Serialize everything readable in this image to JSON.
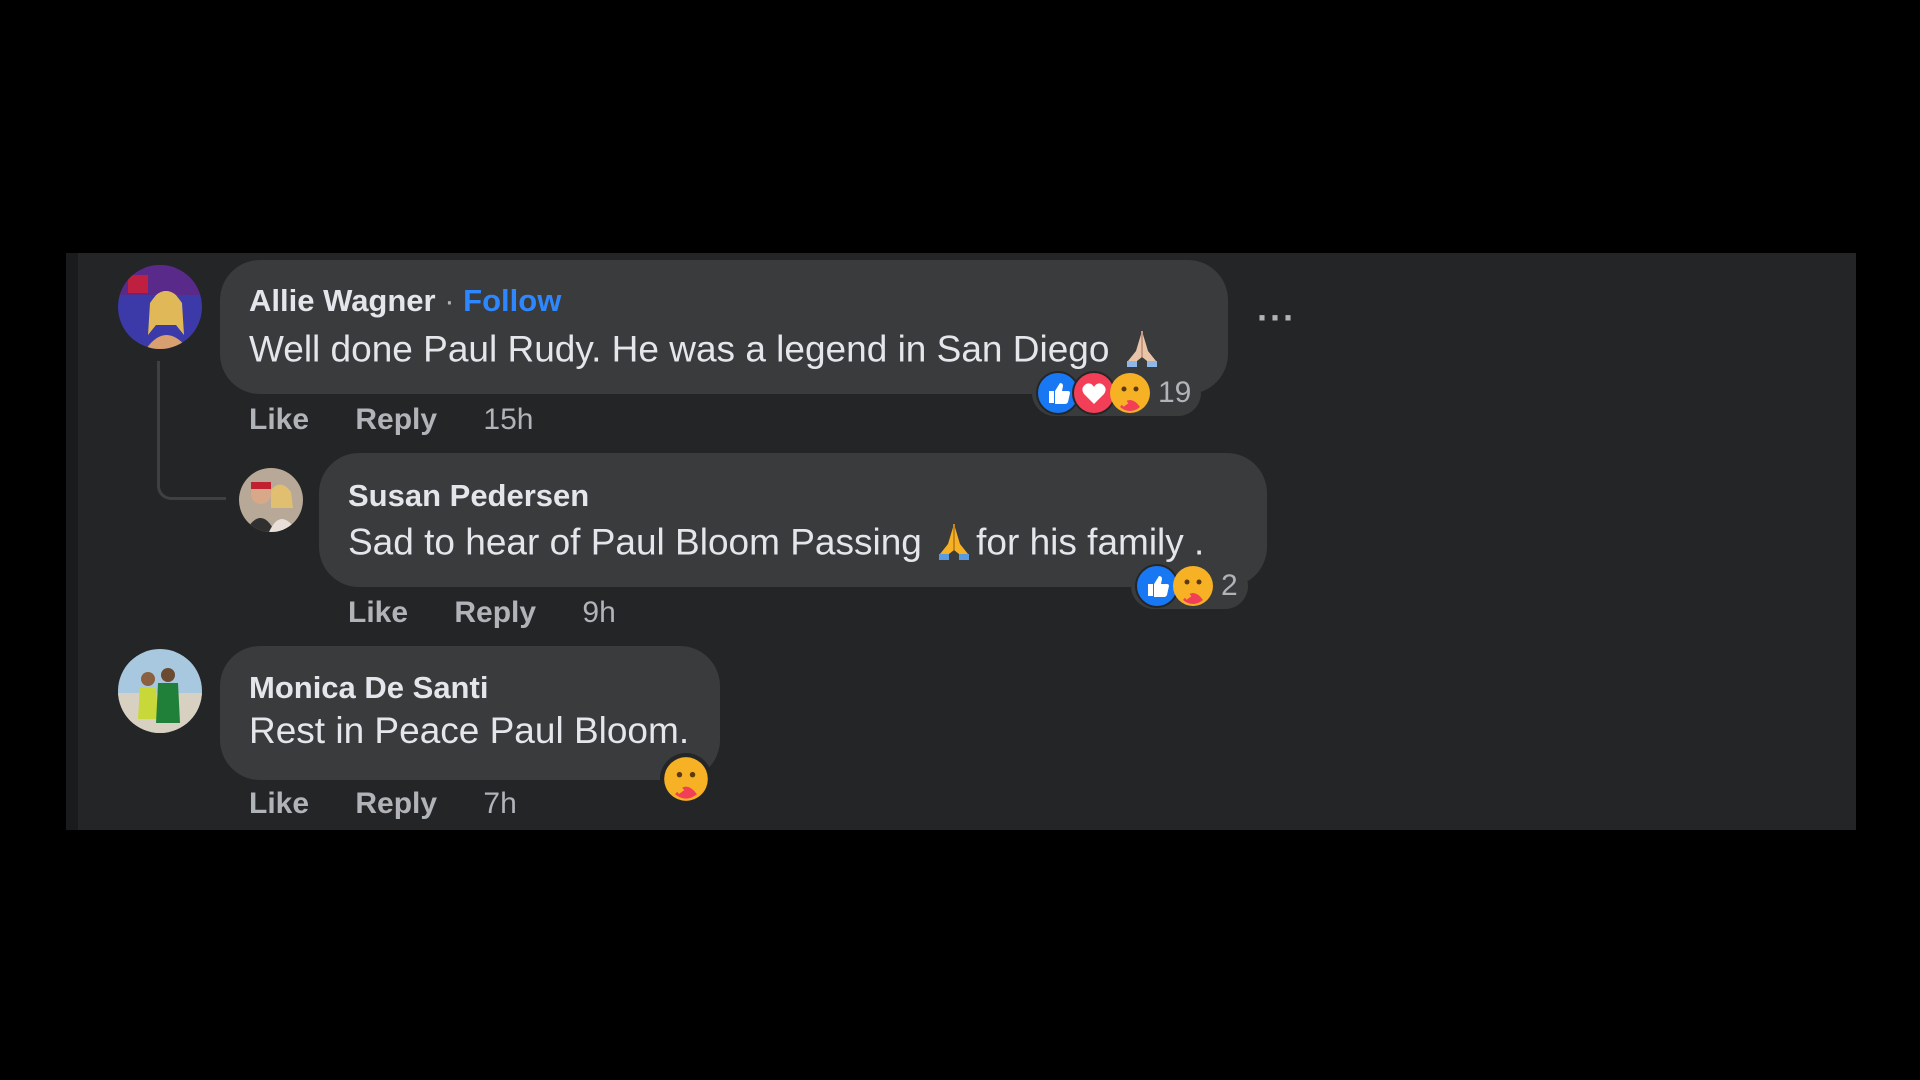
{
  "comments": [
    {
      "author": "Allie Wagner",
      "separator": " · ",
      "follow_label": "Follow",
      "text": "Well done Paul Rudy. He was a legend in San Diego",
      "like_label": "Like",
      "reply_label": "Reply",
      "time": "15h",
      "reaction_count": "19",
      "reactions": [
        "like-icon",
        "love-icon",
        "care-icon"
      ]
    },
    {
      "author": "Susan Pedersen",
      "text_before": "Sad to hear of Paul Bloom Passing",
      "text_after": "for his family .",
      "like_label": "Like",
      "reply_label": "Reply",
      "time": "9h",
      "reaction_count": "2",
      "reactions": [
        "like-icon",
        "care-icon"
      ]
    },
    {
      "author": "Monica De Santi",
      "text": "Rest in Peace Paul Bloom.",
      "like_label": "Like",
      "reply_label": "Reply",
      "time": "7h",
      "reactions": [
        "care-icon"
      ]
    }
  ],
  "more_options": "···",
  "colors": {
    "background": "#242526",
    "bubble": "#3a3b3c",
    "text": "#e4e6eb",
    "secondary": "#b0b3b8",
    "link": "#2d88ff",
    "like": "#1877f2",
    "love": "#f33e58"
  }
}
